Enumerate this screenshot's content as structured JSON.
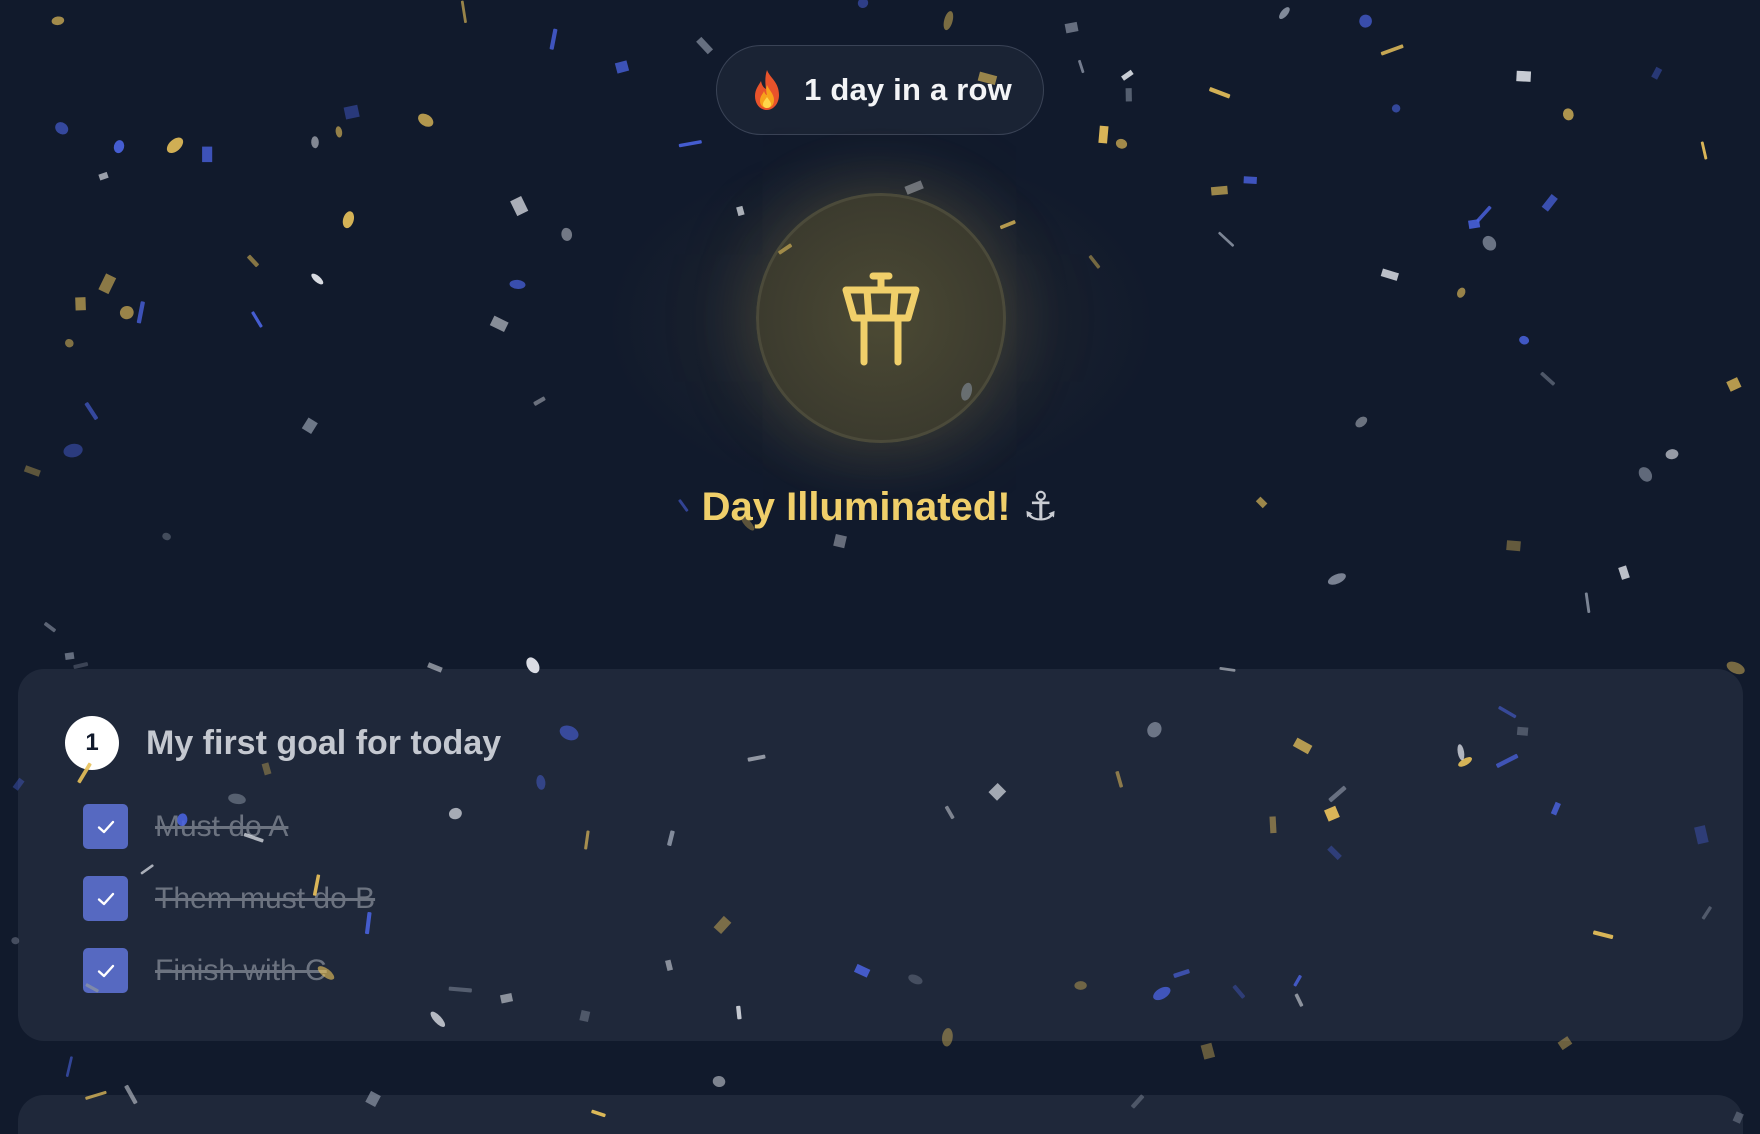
{
  "streak": {
    "icon": "flame-icon",
    "label": "1 day in a row"
  },
  "celebration": {
    "icon": "control-tower-icon",
    "headline": "Day Illuminated!",
    "emoji": "⚓",
    "accent_color": "#f0cf6a"
  },
  "goal": {
    "number": "1",
    "title": "My first goal for today",
    "tasks": [
      {
        "label": "Must do A",
        "checked": true
      },
      {
        "label": "Them must do B",
        "checked": true
      },
      {
        "label": "Finish with C",
        "checked": true
      }
    ]
  },
  "colors": {
    "background": "#111a2c",
    "card": "#1f283a",
    "checkbox": "#5669c1",
    "confetti": [
      "#e8c15a",
      "#4a63e0",
      "#e9ecf2",
      "#8a93a3"
    ]
  }
}
